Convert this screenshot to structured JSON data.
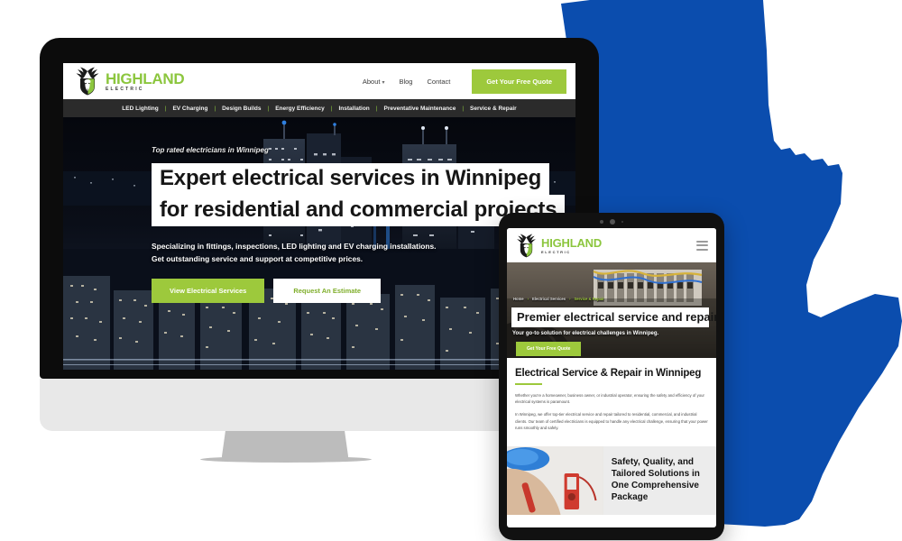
{
  "palette": {
    "brand_green": "#9DC93C",
    "logo_green": "#8CC63E",
    "map_blue": "#0B4DAE",
    "dark_strip": "#2b2b2b",
    "bezel_black": "#0c0c0c",
    "monitor_chin": "#e8e8e8",
    "monitor_stand": "#bcbcbc"
  },
  "desktop": {
    "brand": {
      "name": "HIGHLAND",
      "tagline": "ELECTRIC",
      "logo_icon": "deer-head-shield-logo"
    },
    "top_nav": {
      "items": [
        {
          "label": "About",
          "has_caret": true,
          "caret": "▾"
        },
        {
          "label": "Blog",
          "has_caret": false
        },
        {
          "label": "Contact",
          "has_caret": false
        }
      ],
      "cta_label": "Get Your Free Quote"
    },
    "service_nav": {
      "separator": "|",
      "items": [
        "LED Lighting",
        "EV Charging",
        "Design Builds",
        "Energy Efficiency",
        "Installation",
        "Preventative Maintenance",
        "Service & Repair"
      ]
    },
    "hero": {
      "eyebrow": "Top rated electricians in Winnipeg",
      "headline_line1": "Expert electrical services in Winnipeg",
      "headline_line2": "for residential and commercial projects",
      "subtext_line1": "Specializing in fittings, inspections, LED lighting and EV charging installations.",
      "subtext_line2": "Get outstanding service and support at competitive prices.",
      "primary_button": "View Electrical Services",
      "secondary_button": "Request An Estimate",
      "background_image": "winnipeg-night-skyline-aerial-photo"
    }
  },
  "tablet": {
    "brand": {
      "name": "HIGHLAND",
      "tagline": "ELECTRIC",
      "logo_icon": "deer-head-shield-logo"
    },
    "menu_icon": "hamburger-menu-icon",
    "breadcrumbs": [
      {
        "label": "Home",
        "current": false
      },
      {
        "label": "Electrical Services",
        "current": false
      },
      {
        "label": "Service & Repair",
        "current": true
      }
    ],
    "breadcrumb_separator": "›",
    "hero": {
      "headline": "Premier electrical service and repair",
      "subtext": "Your go-to solution for electrical challenges in Winnipeg.",
      "button": "Get Your Free Quote",
      "background_image": "electrical-panel-wiring-photo"
    },
    "section": {
      "heading": "Electrical Service & Repair in Winnipeg",
      "paragraph1": "Whether you're a homeowner, business owner, or industrial operator, ensuring the safety and efficiency of your electrical systems is paramount.",
      "paragraph2": "In Winnipeg, we offer top-tier electrical service and repair tailored to residential, commercial, and industrial clients. Our team of certified electricians is equipped to handle any electrical challenge, ensuring that your power runs smoothly and safely."
    },
    "card": {
      "title": "Safety, Quality, and Tailored Solutions in One Comprehensive Package",
      "image": "electrician-testing-outlet-photo"
    }
  },
  "decor": {
    "map_shape": "manitoba-province-silhouette"
  }
}
